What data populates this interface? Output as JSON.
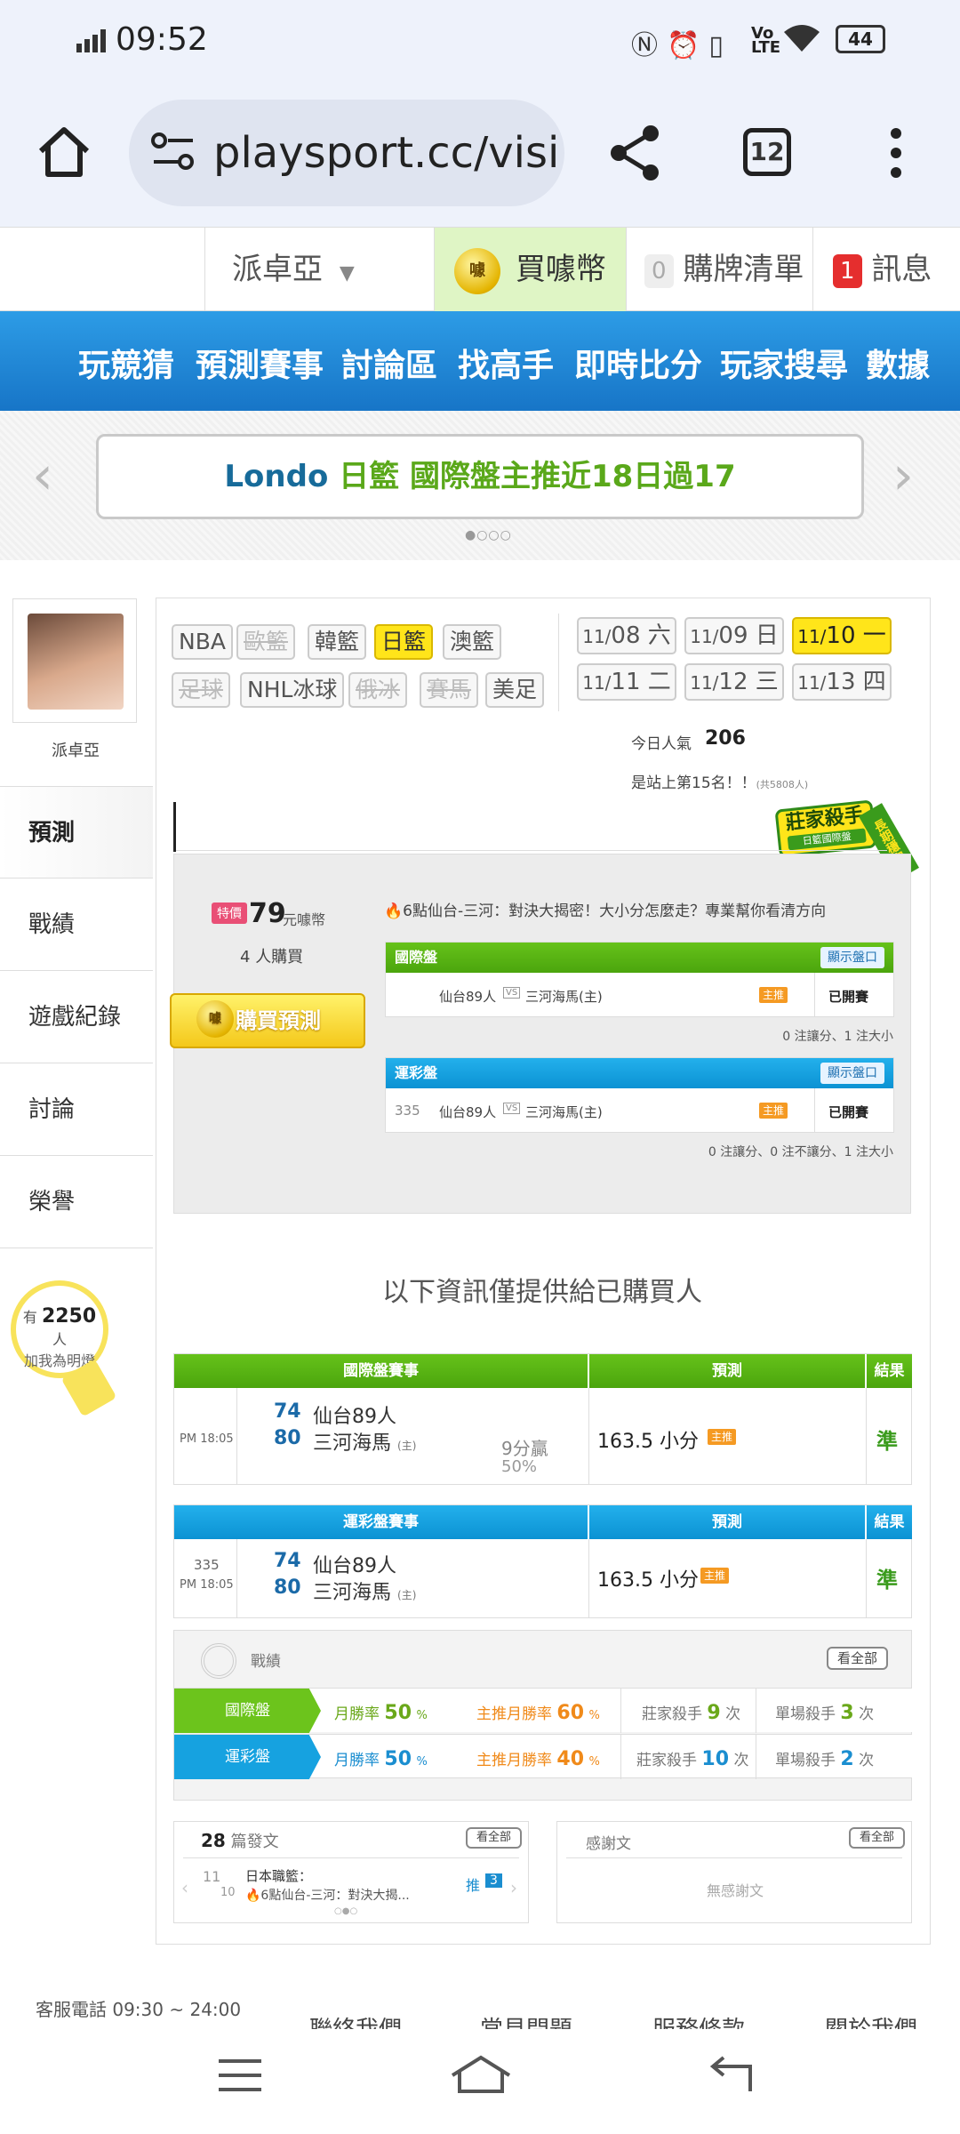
{
  "status_bar": {
    "time": "09:52",
    "battery": "44"
  },
  "browser": {
    "url": "playsport.cc/visi",
    "tab_count": "12"
  },
  "site_nav": {
    "user": "派卓亞",
    "buy_coins": "買噱幣",
    "coin_glyph": "噱",
    "cart_count": "0",
    "cart_label": "購牌清單",
    "msg_count": "1",
    "msg_label": "訊息"
  },
  "main_menu": [
    "玩競猜",
    "預測賽事",
    "討論區",
    "找高手",
    "即時比分",
    "玩家搜尋",
    "數據"
  ],
  "banner": {
    "prefix": "Londo",
    "text": "日籃 國際盤主推近18日過17"
  },
  "profile": {
    "name": "派卓亞",
    "side_menu": [
      "預測",
      "戰績",
      "遊戲紀錄",
      "討論",
      "榮譽"
    ],
    "fans_prefix": "有",
    "fans_count": "2250",
    "fans_suffix": "人",
    "follow_label": "加我為明燈"
  },
  "leagues": {
    "row1": [
      {
        "label": "NBA",
        "state": "normal"
      },
      {
        "label": "歐籃",
        "state": "disabled"
      },
      {
        "label": "韓籃",
        "state": "normal"
      },
      {
        "label": "日籃",
        "state": "active"
      },
      {
        "label": "澳籃",
        "state": "normal"
      }
    ],
    "row2": [
      {
        "label": "足球",
        "state": "disabled"
      },
      {
        "label": "NHL冰球",
        "state": "normal"
      },
      {
        "label": "俄冰",
        "state": "disabled"
      },
      {
        "label": "賽馬",
        "state": "disabled"
      },
      {
        "label": "美足",
        "state": "normal"
      }
    ]
  },
  "dates": {
    "row1": [
      {
        "month": "11/",
        "day": "08 六",
        "active": false
      },
      {
        "month": "11/",
        "day": "09 日",
        "active": false
      },
      {
        "month": "11/",
        "day": "10 一",
        "active": true
      }
    ],
    "row2": [
      {
        "month": "11/",
        "day": "11 二",
        "active": false
      },
      {
        "month": "11/",
        "day": "12 三",
        "active": false
      },
      {
        "month": "11/",
        "day": "13 四",
        "active": false
      }
    ]
  },
  "popularity": {
    "label": "今日人氣",
    "value": "206",
    "rank_text": "是站上第15名！！",
    "rank_total": "(共5808人)",
    "award_title": "莊家殺手",
    "award_sub": "日籃國際盤",
    "award_ribbon": "長期穩定"
  },
  "prediction": {
    "special_tag": "特價",
    "price": "79",
    "price_unit": "元噱幣",
    "buyers_count": "4",
    "buyers_label": "人購買",
    "buy_button": "購買預測",
    "headline": "🔥6點仙台-三河：對決大揭密！大小分怎麼走？專業幫你看清方向",
    "intl": {
      "title": "國際盤",
      "show_odds": "顯示盤口",
      "home_team": "仙台89人",
      "vs": "VS",
      "away_team": "三河海馬(主)",
      "host_tag": "主推",
      "status": "已開賽",
      "note": "0 注讓分、1 注大小"
    },
    "sports_lottery": {
      "title": "運彩盤",
      "show_odds": "顯示盤口",
      "game_no": "335",
      "home_team": "仙台89人",
      "vs": "VS",
      "away_team": "三河海馬(主)",
      "host_tag": "主推",
      "status": "已開賽",
      "note": "0 注讓分、0 注不讓分、1 注大小"
    }
  },
  "buyers_only": "以下資訊僅提供給已購買人",
  "intl_table": {
    "headers": [
      "國際盤賽事",
      "預測",
      "結果"
    ],
    "time": "PM 18:05",
    "team1_score": "74",
    "team1": "仙台89人",
    "team2_score": "80",
    "team2": "三河海馬",
    "team2_tag": "(主)",
    "win_note": "9分贏",
    "pct": "50%",
    "pick": "163.5 小分",
    "host_tag": "主推",
    "result": "準"
  },
  "lottery_table": {
    "headers": [
      "運彩盤賽事",
      "預測",
      "結果"
    ],
    "game_no": "335",
    "time": "PM 18:05",
    "team1_score": "74",
    "team1": "仙台89人",
    "team2_score": "80",
    "team2": "三河海馬",
    "team2_tag": "(主)",
    "pick": "163.5 小分",
    "host_tag": "主推",
    "result": "準"
  },
  "record": {
    "title": "戰績",
    "view_all": "看全部",
    "rows": [
      {
        "label": "國際盤",
        "month_rate_label": "月勝率",
        "month_rate": "50",
        "main_rate_label": "主推月勝率",
        "main_rate": "60",
        "killer_label": "莊家殺手",
        "killer": "9",
        "single_label": "單場殺手",
        "single": "3",
        "unit": "次",
        "pct": "%"
      },
      {
        "label": "運彩盤",
        "month_rate_label": "月勝率",
        "month_rate": "50",
        "main_rate_label": "主推月勝率",
        "main_rate": "40",
        "killer_label": "莊家殺手",
        "killer": "10",
        "single_label": "單場殺手",
        "single": "2",
        "unit": "次",
        "pct": "%"
      }
    ]
  },
  "posts": {
    "count": "28",
    "label": "篇發文",
    "view_all": "看全部",
    "item_month": "11",
    "item_day": "10",
    "item_title": "日本職籃：",
    "item_desc": "🔥6點仙台-三河：對決大揭...",
    "push_label": "推",
    "push_count": "3"
  },
  "thanks": {
    "label": "感謝文",
    "view_all": "看全部",
    "empty": "無感謝文"
  },
  "footer": {
    "service_hours": "客服電話 09:30 ~ 24:00",
    "links": [
      "聯絡我們",
      "常見問題",
      "服務條款",
      "關於我們"
    ]
  },
  "colors": {
    "blue_menu": "#1f89d8",
    "green": "#4ba50d",
    "sky": "#0b92d3",
    "yellow": "#ffe51a",
    "orange": "#f59a23"
  }
}
